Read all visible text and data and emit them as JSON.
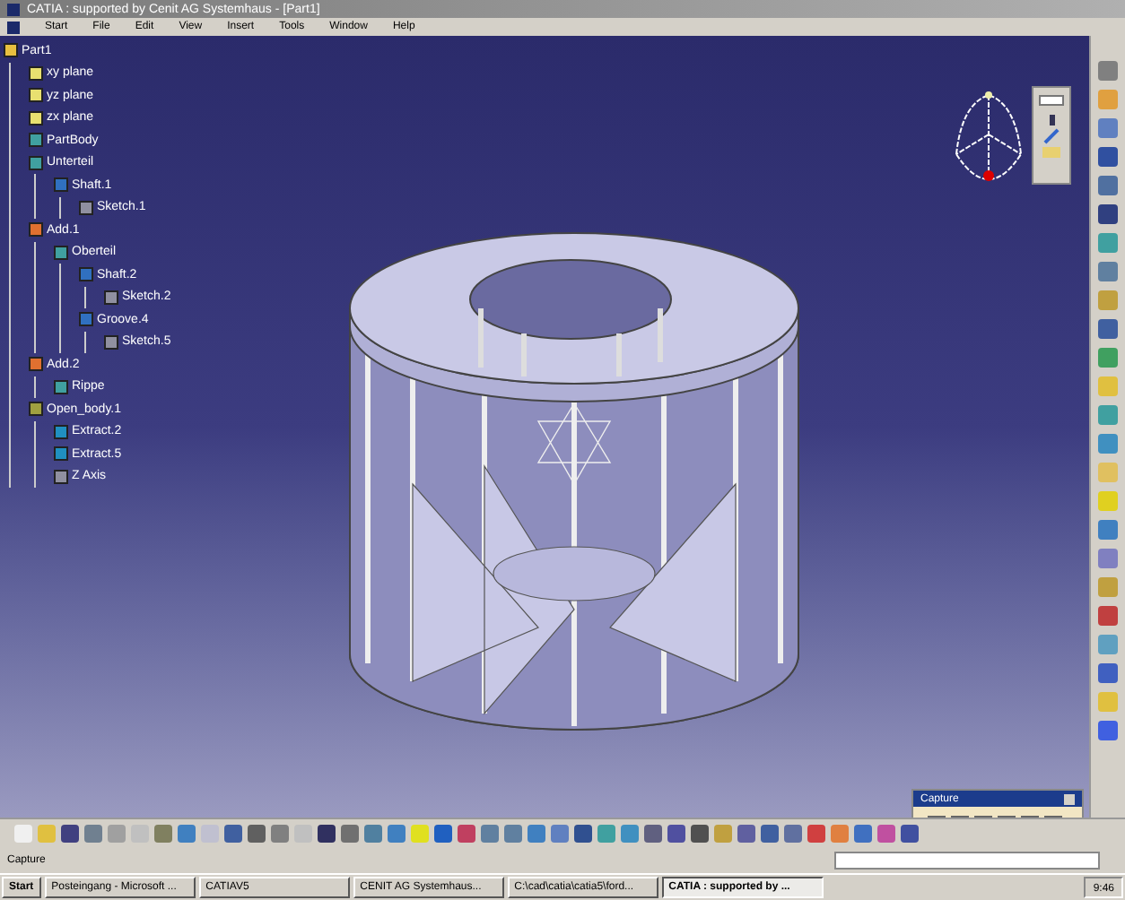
{
  "window": {
    "title": "CATIA : supported by Cenit AG Systemhaus - [Part1]"
  },
  "menu": [
    "Start",
    "File",
    "Edit",
    "View",
    "Insert",
    "Tools",
    "Window",
    "Help"
  ],
  "tree": {
    "label": "Part1",
    "kind": "part",
    "children": [
      {
        "label": "xy plane",
        "kind": "plane"
      },
      {
        "label": "yz plane",
        "kind": "plane"
      },
      {
        "label": "zx plane",
        "kind": "plane"
      },
      {
        "label": "PartBody",
        "kind": "body"
      },
      {
        "label": "Unterteil",
        "kind": "body",
        "children": [
          {
            "label": "Shaft.1",
            "kind": "feature",
            "children": [
              {
                "label": "Sketch.1",
                "kind": "sketch"
              }
            ]
          }
        ]
      },
      {
        "label": "Add.1",
        "kind": "bool",
        "children": [
          {
            "label": "Oberteil",
            "kind": "body",
            "children": [
              {
                "label": "Shaft.2",
                "kind": "feature",
                "children": [
                  {
                    "label": "Sketch.2",
                    "kind": "sketch"
                  }
                ]
              },
              {
                "label": "Groove.4",
                "kind": "feature",
                "children": [
                  {
                    "label": "Sketch.5",
                    "kind": "sketch"
                  }
                ]
              }
            ]
          }
        ]
      },
      {
        "label": "Add.2",
        "kind": "bool",
        "children": [
          {
            "label": "Rippe",
            "kind": "body"
          }
        ]
      },
      {
        "label": "Open_body.1",
        "kind": "geo",
        "children": [
          {
            "label": "Extract.2",
            "kind": "surface"
          },
          {
            "label": "Extract.5",
            "kind": "surface"
          },
          {
            "label": "Z Axis",
            "kind": "sketch"
          }
        ]
      }
    ]
  },
  "capture_toolbar": {
    "title": "Capture"
  },
  "status_bar": {
    "text": "Capture"
  },
  "taskbar": {
    "start": "Start",
    "tasks": [
      {
        "label": "Posteingang - Microsoft ...",
        "selected": false
      },
      {
        "label": "CATIAV5",
        "selected": false
      },
      {
        "label": "CENIT AG Systemhaus...",
        "selected": false
      },
      {
        "label": "C:\\cad\\catia\\catia5\\ford...",
        "selected": false
      },
      {
        "label": "CATIA : supported by ...",
        "selected": true
      }
    ],
    "clock": "9:46"
  }
}
